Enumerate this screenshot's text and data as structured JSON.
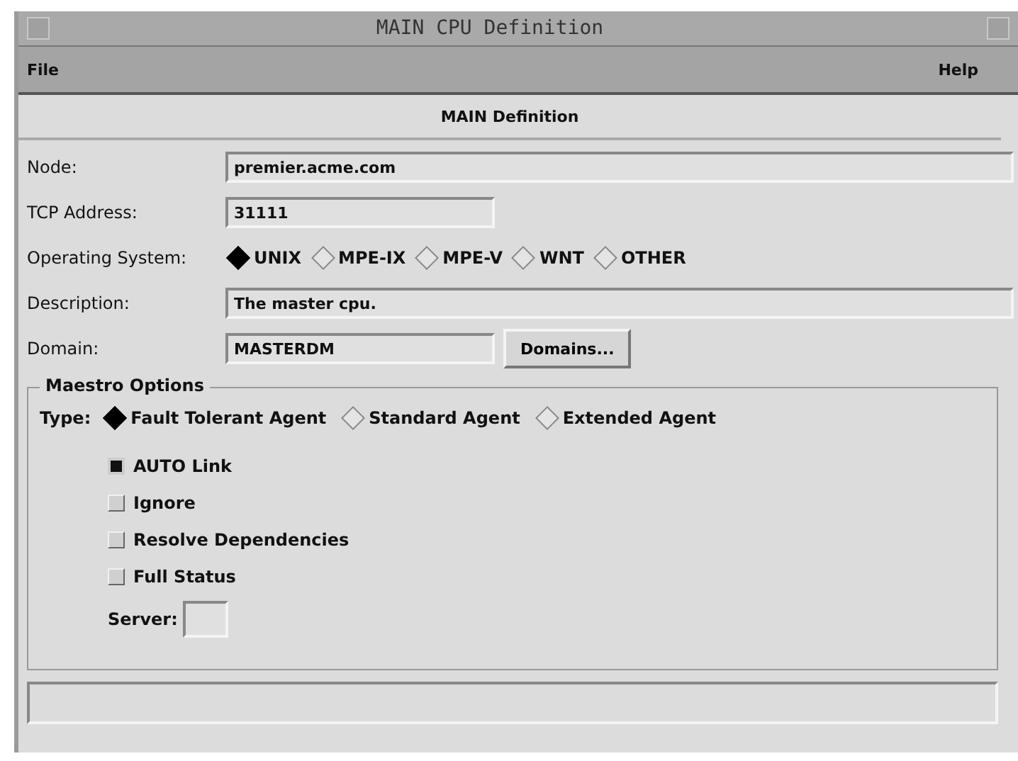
{
  "window": {
    "title": "MAIN CPU Definition"
  },
  "menu": [
    "File",
    "Help"
  ],
  "header": "MAIN Definition",
  "form": {
    "node": {
      "label": "Node:",
      "value": "premier.acme.com"
    },
    "tcp": {
      "label": "TCP Address:",
      "value": "31111"
    },
    "os": {
      "label": "Operating System:",
      "options": [
        {
          "label": "UNIX",
          "selected": true
        },
        {
          "label": "MPE-IX",
          "selected": false
        },
        {
          "label": "MPE-V",
          "selected": false
        },
        {
          "label": "WNT",
          "selected": false
        },
        {
          "label": "OTHER",
          "selected": false
        }
      ]
    },
    "description": {
      "label": "Description:",
      "value": "The master cpu."
    },
    "domain": {
      "label": "Domain:",
      "value": "MASTERDM",
      "button": "Domains..."
    }
  },
  "maestro": {
    "title": "Maestro Options",
    "type_label": "Type:",
    "types": [
      {
        "label": "Fault Tolerant Agent",
        "selected": true
      },
      {
        "label": "Standard Agent",
        "selected": false
      },
      {
        "label": "Extended Agent",
        "selected": false
      }
    ],
    "checks": [
      {
        "label": "AUTO Link",
        "checked": true
      },
      {
        "label": "Ignore",
        "checked": false
      },
      {
        "label": "Resolve Dependencies",
        "checked": false
      },
      {
        "label": "Full Status",
        "checked": false
      }
    ],
    "server_label": "Server:"
  }
}
